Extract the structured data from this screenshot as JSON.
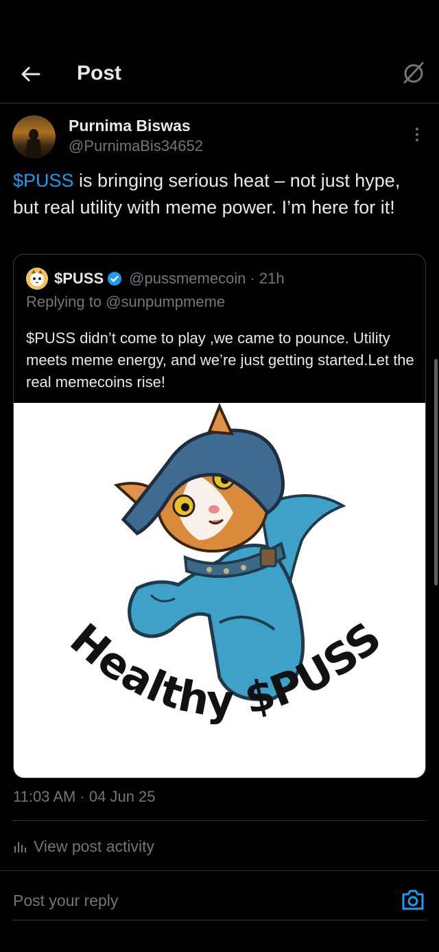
{
  "header": {
    "title": "Post"
  },
  "author": {
    "name": "Purnima Biswas",
    "handle": "@PurnimaBis34652"
  },
  "post": {
    "cashtag": "$PUSS",
    "text": " is bringing serious heat – not just hype, but real utility with meme power. I’m here for it!"
  },
  "quote": {
    "name": "$PUSS",
    "handle": "@pussmemecoin",
    "time": "· 21h",
    "replying_to": "Replying to @sunpumpmeme",
    "text": "$PUSS didn’t come to play ,we came to pounce. Utility meets meme energy, and we’re just getting started.Let the real memecoins rise!",
    "image_caption": "Healthy $PUSS"
  },
  "meta": {
    "timestamp": "11:03 AM · 04 Jun 25",
    "activity_label": "View post activity"
  },
  "reply": {
    "placeholder": "Post your reply"
  },
  "colors": {
    "accent": "#1d9bf0",
    "background": "#000000",
    "muted": "#71767b",
    "text": "#e7e9ea"
  }
}
